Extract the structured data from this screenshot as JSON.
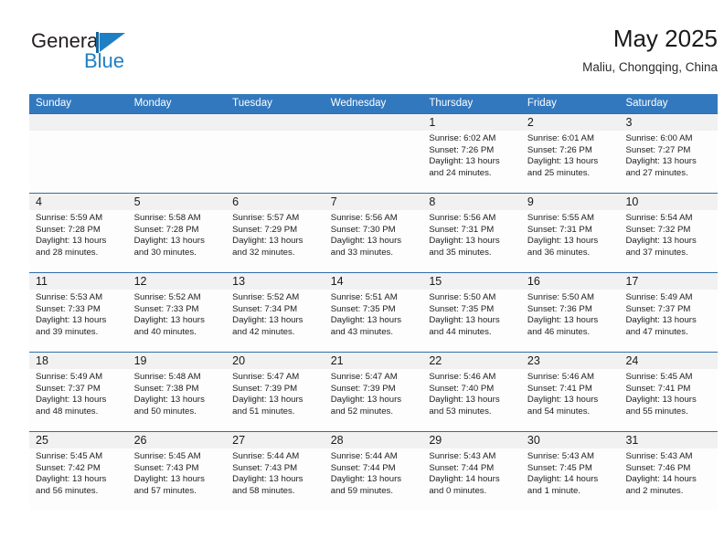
{
  "brand": {
    "name_top": "General",
    "name_bottom": "Blue",
    "mark": "triangle-logo"
  },
  "header": {
    "title": "May 2025",
    "subtitle": "Maliu, Chongqing, China"
  },
  "weekdays": [
    "Sunday",
    "Monday",
    "Tuesday",
    "Wednesday",
    "Thursday",
    "Friday",
    "Saturday"
  ],
  "weeks": [
    [
      {
        "day": "",
        "lines": []
      },
      {
        "day": "",
        "lines": []
      },
      {
        "day": "",
        "lines": []
      },
      {
        "day": "",
        "lines": []
      },
      {
        "day": "1",
        "lines": [
          "Sunrise: 6:02 AM",
          "Sunset: 7:26 PM",
          "Daylight: 13 hours",
          "and 24 minutes."
        ]
      },
      {
        "day": "2",
        "lines": [
          "Sunrise: 6:01 AM",
          "Sunset: 7:26 PM",
          "Daylight: 13 hours",
          "and 25 minutes."
        ]
      },
      {
        "day": "3",
        "lines": [
          "Sunrise: 6:00 AM",
          "Sunset: 7:27 PM",
          "Daylight: 13 hours",
          "and 27 minutes."
        ]
      }
    ],
    [
      {
        "day": "4",
        "lines": [
          "Sunrise: 5:59 AM",
          "Sunset: 7:28 PM",
          "Daylight: 13 hours",
          "and 28 minutes."
        ]
      },
      {
        "day": "5",
        "lines": [
          "Sunrise: 5:58 AM",
          "Sunset: 7:28 PM",
          "Daylight: 13 hours",
          "and 30 minutes."
        ]
      },
      {
        "day": "6",
        "lines": [
          "Sunrise: 5:57 AM",
          "Sunset: 7:29 PM",
          "Daylight: 13 hours",
          "and 32 minutes."
        ]
      },
      {
        "day": "7",
        "lines": [
          "Sunrise: 5:56 AM",
          "Sunset: 7:30 PM",
          "Daylight: 13 hours",
          "and 33 minutes."
        ]
      },
      {
        "day": "8",
        "lines": [
          "Sunrise: 5:56 AM",
          "Sunset: 7:31 PM",
          "Daylight: 13 hours",
          "and 35 minutes."
        ]
      },
      {
        "day": "9",
        "lines": [
          "Sunrise: 5:55 AM",
          "Sunset: 7:31 PM",
          "Daylight: 13 hours",
          "and 36 minutes."
        ]
      },
      {
        "day": "10",
        "lines": [
          "Sunrise: 5:54 AM",
          "Sunset: 7:32 PM",
          "Daylight: 13 hours",
          "and 37 minutes."
        ]
      }
    ],
    [
      {
        "day": "11",
        "lines": [
          "Sunrise: 5:53 AM",
          "Sunset: 7:33 PM",
          "Daylight: 13 hours",
          "and 39 minutes."
        ]
      },
      {
        "day": "12",
        "lines": [
          "Sunrise: 5:52 AM",
          "Sunset: 7:33 PM",
          "Daylight: 13 hours",
          "and 40 minutes."
        ]
      },
      {
        "day": "13",
        "lines": [
          "Sunrise: 5:52 AM",
          "Sunset: 7:34 PM",
          "Daylight: 13 hours",
          "and 42 minutes."
        ]
      },
      {
        "day": "14",
        "lines": [
          "Sunrise: 5:51 AM",
          "Sunset: 7:35 PM",
          "Daylight: 13 hours",
          "and 43 minutes."
        ]
      },
      {
        "day": "15",
        "lines": [
          "Sunrise: 5:50 AM",
          "Sunset: 7:35 PM",
          "Daylight: 13 hours",
          "and 44 minutes."
        ]
      },
      {
        "day": "16",
        "lines": [
          "Sunrise: 5:50 AM",
          "Sunset: 7:36 PM",
          "Daylight: 13 hours",
          "and 46 minutes."
        ]
      },
      {
        "day": "17",
        "lines": [
          "Sunrise: 5:49 AM",
          "Sunset: 7:37 PM",
          "Daylight: 13 hours",
          "and 47 minutes."
        ]
      }
    ],
    [
      {
        "day": "18",
        "lines": [
          "Sunrise: 5:49 AM",
          "Sunset: 7:37 PM",
          "Daylight: 13 hours",
          "and 48 minutes."
        ]
      },
      {
        "day": "19",
        "lines": [
          "Sunrise: 5:48 AM",
          "Sunset: 7:38 PM",
          "Daylight: 13 hours",
          "and 50 minutes."
        ]
      },
      {
        "day": "20",
        "lines": [
          "Sunrise: 5:47 AM",
          "Sunset: 7:39 PM",
          "Daylight: 13 hours",
          "and 51 minutes."
        ]
      },
      {
        "day": "21",
        "lines": [
          "Sunrise: 5:47 AM",
          "Sunset: 7:39 PM",
          "Daylight: 13 hours",
          "and 52 minutes."
        ]
      },
      {
        "day": "22",
        "lines": [
          "Sunrise: 5:46 AM",
          "Sunset: 7:40 PM",
          "Daylight: 13 hours",
          "and 53 minutes."
        ]
      },
      {
        "day": "23",
        "lines": [
          "Sunrise: 5:46 AM",
          "Sunset: 7:41 PM",
          "Daylight: 13 hours",
          "and 54 minutes."
        ]
      },
      {
        "day": "24",
        "lines": [
          "Sunrise: 5:45 AM",
          "Sunset: 7:41 PM",
          "Daylight: 13 hours",
          "and 55 minutes."
        ]
      }
    ],
    [
      {
        "day": "25",
        "lines": [
          "Sunrise: 5:45 AM",
          "Sunset: 7:42 PM",
          "Daylight: 13 hours",
          "and 56 minutes."
        ]
      },
      {
        "day": "26",
        "lines": [
          "Sunrise: 5:45 AM",
          "Sunset: 7:43 PM",
          "Daylight: 13 hours",
          "and 57 minutes."
        ]
      },
      {
        "day": "27",
        "lines": [
          "Sunrise: 5:44 AM",
          "Sunset: 7:43 PM",
          "Daylight: 13 hours",
          "and 58 minutes."
        ]
      },
      {
        "day": "28",
        "lines": [
          "Sunrise: 5:44 AM",
          "Sunset: 7:44 PM",
          "Daylight: 13 hours",
          "and 59 minutes."
        ]
      },
      {
        "day": "29",
        "lines": [
          "Sunrise: 5:43 AM",
          "Sunset: 7:44 PM",
          "Daylight: 14 hours",
          "and 0 minutes."
        ]
      },
      {
        "day": "30",
        "lines": [
          "Sunrise: 5:43 AM",
          "Sunset: 7:45 PM",
          "Daylight: 14 hours",
          "and 1 minute."
        ]
      },
      {
        "day": "31",
        "lines": [
          "Sunrise: 5:43 AM",
          "Sunset: 7:46 PM",
          "Daylight: 14 hours",
          "and 2 minutes."
        ]
      }
    ]
  ],
  "colors": {
    "header_blue": "#3278be",
    "rule_blue": "#2f6fa8",
    "brand_blue": "#1f7fc4",
    "daynum_band": "#f1f1f1"
  }
}
